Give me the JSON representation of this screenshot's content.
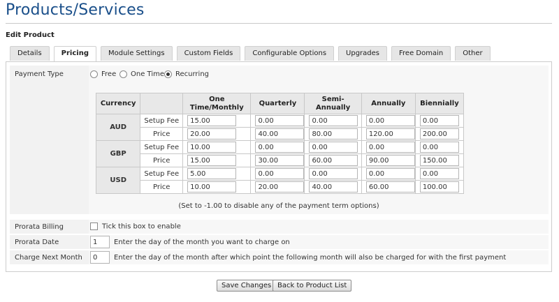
{
  "page": {
    "title": "Products/Services",
    "subtitle": "Edit Product"
  },
  "tabs": [
    {
      "label": "Details"
    },
    {
      "label": "Pricing",
      "active": true
    },
    {
      "label": "Module Settings"
    },
    {
      "label": "Custom Fields"
    },
    {
      "label": "Configurable Options"
    },
    {
      "label": "Upgrades"
    },
    {
      "label": "Free Domain"
    },
    {
      "label": "Other"
    }
  ],
  "payment_type": {
    "label": "Payment Type",
    "options": [
      "Free",
      "One Time",
      "Recurring"
    ],
    "selected": "Recurring"
  },
  "pricing": {
    "headers": [
      "Currency",
      "",
      "One Time/Monthly",
      "Quarterly",
      "Semi-Annually",
      "Annually",
      "Biennially"
    ],
    "row_labels": [
      "Setup Fee",
      "Price"
    ],
    "currencies": [
      {
        "code": "AUD",
        "setup": [
          "15.00",
          "0.00",
          "0.00",
          "0.00",
          "0.00"
        ],
        "price": [
          "20.00",
          "40.00",
          "80.00",
          "120.00",
          "200.00"
        ]
      },
      {
        "code": "GBP",
        "setup": [
          "10.00",
          "0.00",
          "0.00",
          "0.00",
          "0.00"
        ],
        "price": [
          "15.00",
          "30.00",
          "60.00",
          "90.00",
          "150.00"
        ]
      },
      {
        "code": "USD",
        "setup": [
          "5.00",
          "0.00",
          "0.00",
          "0.00",
          "0.00"
        ],
        "price": [
          "10.00",
          "20.00",
          "40.00",
          "60.00",
          "100.00"
        ]
      }
    ],
    "note": "(Set to -1.00 to disable any of the payment term options)"
  },
  "prorata_billing": {
    "label": "Prorata Billing",
    "text": "Tick this box to enable",
    "checked": false
  },
  "prorata_date": {
    "label": "Prorata Date",
    "value": "1",
    "text": "Enter the day of the month you want to charge on"
  },
  "charge_next_month": {
    "label": "Charge Next Month",
    "value": "0",
    "text": "Enter the day of the month after which point the following month will also be charged for with the first payment"
  },
  "buttons": {
    "save": "Save Changes",
    "back": "Back to Product List"
  },
  "colors": {
    "title": "#1a4f8a",
    "row_bg": "#f2f2f2",
    "header_bg": "#e8e8e8"
  }
}
